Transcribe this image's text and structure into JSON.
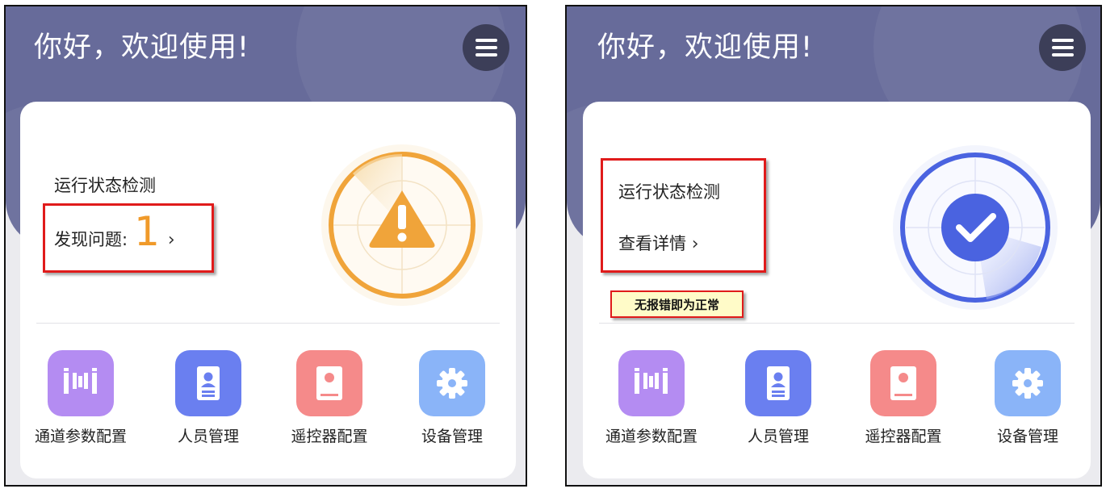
{
  "left_panel": {
    "greeting": "你好，欢迎使用!",
    "status_title": "运行状态检测",
    "issues_label": "发现问题:",
    "issues_count": "1",
    "chevron": "›",
    "status_icon": "warning-icon",
    "status_color": "#f0a43a",
    "shortcuts": [
      {
        "label": "通道参数配置",
        "icon": "channel-config-icon",
        "color": "#b48cf2"
      },
      {
        "label": "人员管理",
        "icon": "personnel-icon",
        "color": "#6a7ff0"
      },
      {
        "label": "遥控器配置",
        "icon": "remote-config-icon",
        "color": "#f58a8a"
      },
      {
        "label": "设备管理",
        "icon": "gear-icon",
        "color": "#8ab4f8"
      }
    ]
  },
  "right_panel": {
    "greeting": "你好，欢迎使用!",
    "status_title": "运行状态检测",
    "details_link": "查看详情",
    "chevron": "›",
    "annotation": "无报错即为正常",
    "status_icon": "checkmark-icon",
    "status_color": "#4a63e0",
    "shortcuts": [
      {
        "label": "通道参数配置",
        "icon": "channel-config-icon",
        "color": "#b48cf2"
      },
      {
        "label": "人员管理",
        "icon": "personnel-icon",
        "color": "#6a7ff0"
      },
      {
        "label": "遥控器配置",
        "icon": "remote-config-icon",
        "color": "#f58a8a"
      },
      {
        "label": "设备管理",
        "icon": "gear-icon",
        "color": "#8ab4f8"
      }
    ]
  }
}
